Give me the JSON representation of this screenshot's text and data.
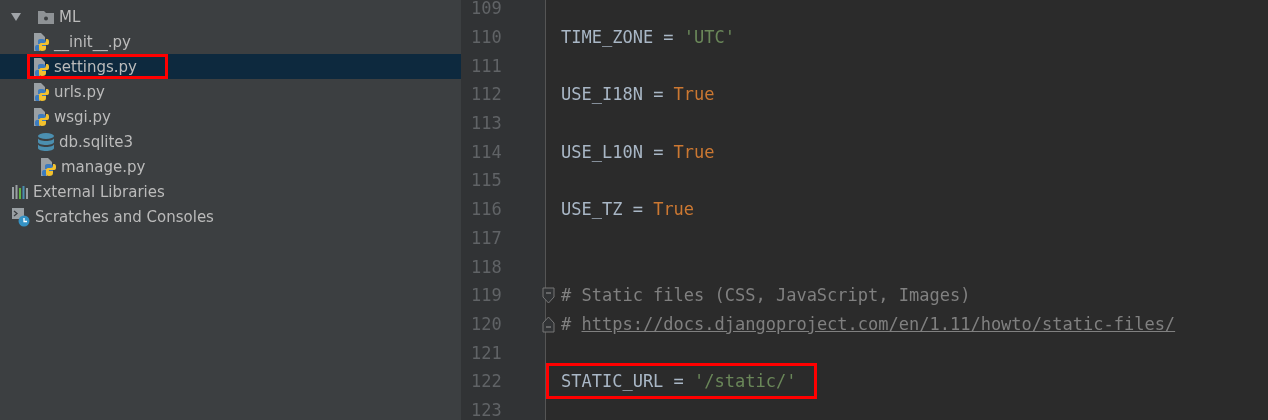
{
  "project_tree": {
    "project_children": [
      {
        "kind": "folder",
        "label": "ML",
        "expanded": true,
        "selected": false,
        "highlighted": false,
        "children": [
          {
            "kind": "python",
            "label": "__init__.py",
            "selected": false,
            "highlighted": false
          },
          {
            "kind": "python",
            "label": "settings.py",
            "selected": true,
            "highlighted": true
          },
          {
            "kind": "python",
            "label": "urls.py",
            "selected": false,
            "highlighted": false
          },
          {
            "kind": "python",
            "label": "wsgi.py",
            "selected": false,
            "highlighted": false
          }
        ]
      },
      {
        "kind": "database",
        "label": "db.sqlite3",
        "selected": false,
        "highlighted": false
      },
      {
        "kind": "python",
        "label": "manage.py",
        "selected": false,
        "highlighted": false
      }
    ],
    "root_items": [
      {
        "kind": "libraries",
        "label": "External Libraries",
        "selected": false,
        "highlighted": false
      },
      {
        "kind": "scratches",
        "label": "Scratches and Consoles",
        "selected": false,
        "highlighted": false
      }
    ]
  },
  "editor": {
    "lines": [
      {
        "number": "109",
        "highlighted": false
      },
      {
        "number": "110",
        "highlighted": false,
        "tokens": [
          {
            "kind": "name",
            "text": "TIME_ZONE"
          },
          {
            "kind": "operator",
            "text": "="
          },
          {
            "kind": "string",
            "text": "'UTC'"
          }
        ]
      },
      {
        "number": "111",
        "highlighted": false
      },
      {
        "number": "112",
        "highlighted": false,
        "tokens": [
          {
            "kind": "name",
            "text": "USE_I18N"
          },
          {
            "kind": "operator",
            "text": "="
          },
          {
            "kind": "keyword",
            "text": "True"
          }
        ]
      },
      {
        "number": "113",
        "highlighted": false
      },
      {
        "number": "114",
        "highlighted": false,
        "tokens": [
          {
            "kind": "name",
            "text": "USE_L10N"
          },
          {
            "kind": "operator",
            "text": "="
          },
          {
            "kind": "keyword",
            "text": "True"
          }
        ]
      },
      {
        "number": "115",
        "highlighted": false
      },
      {
        "number": "116",
        "highlighted": false,
        "tokens": [
          {
            "kind": "name",
            "text": "USE_TZ"
          },
          {
            "kind": "operator",
            "text": "="
          },
          {
            "kind": "keyword",
            "text": "True"
          }
        ]
      },
      {
        "number": "117",
        "highlighted": false
      },
      {
        "number": "118",
        "highlighted": false
      },
      {
        "number": "119",
        "highlighted": false,
        "fold_start": true,
        "tokens": [
          {
            "kind": "comment",
            "text": "# Static files (CSS, JavaScript, Images)"
          }
        ]
      },
      {
        "number": "120",
        "highlighted": false,
        "fold_end": true,
        "tokens": [
          {
            "kind": "comment",
            "text": "#"
          },
          {
            "kind": "link",
            "text": "https://docs.djangoproject.com/en/1.11/howto/static-files/"
          }
        ]
      },
      {
        "number": "121",
        "highlighted": false
      },
      {
        "number": "122",
        "highlighted": true,
        "tokens": [
          {
            "kind": "name",
            "text": "STATIC_URL"
          },
          {
            "kind": "operator",
            "text": "="
          },
          {
            "kind": "string",
            "text": "'/static/'"
          }
        ]
      },
      {
        "number": "123",
        "highlighted": false
      }
    ]
  }
}
